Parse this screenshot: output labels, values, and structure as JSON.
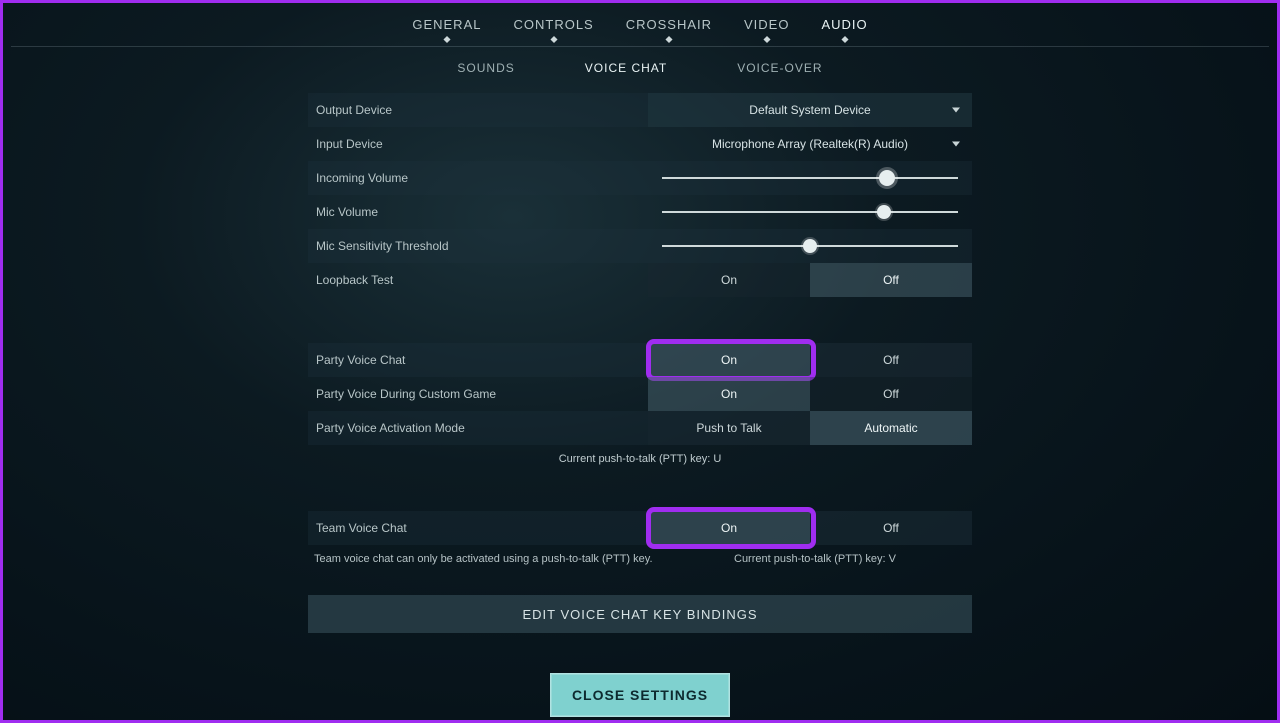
{
  "top_tabs": {
    "general": "GENERAL",
    "controls": "CONTROLS",
    "crosshair": "CROSSHAIR",
    "video": "VIDEO",
    "audio": "AUDIO"
  },
  "sub_tabs": {
    "sounds": "SOUNDS",
    "voice_chat": "VOICE CHAT",
    "voice_over": "VOICE-OVER"
  },
  "settings": {
    "output_device": {
      "label": "Output Device",
      "value": "Default System Device"
    },
    "input_device": {
      "label": "Input Device",
      "value": "Microphone Array (Realtek(R) Audio)"
    },
    "incoming_volume": {
      "label": "Incoming Volume",
      "percent": 76
    },
    "mic_volume": {
      "label": "Mic Volume",
      "percent": 75
    },
    "mic_sensitivity": {
      "label": "Mic Sensitivity Threshold",
      "percent": 50
    },
    "loopback": {
      "label": "Loopback Test",
      "on": "On",
      "off": "Off",
      "selected": "Off"
    },
    "party_voice": {
      "label": "Party Voice Chat",
      "on": "On",
      "off": "Off",
      "selected": "On"
    },
    "party_custom": {
      "label": "Party Voice During Custom Game",
      "on": "On",
      "off": "Off",
      "selected": "On"
    },
    "party_mode": {
      "label": "Party Voice Activation Mode",
      "a": "Push to Talk",
      "b": "Automatic",
      "selected": "Automatic"
    },
    "party_ptt_note": "Current push-to-talk (PTT) key: U",
    "team_voice": {
      "label": "Team Voice Chat",
      "on": "On",
      "off": "Off",
      "selected": "On"
    },
    "team_note_left": "Team voice chat can only be activated using a push-to-talk (PTT) key.",
    "team_note_right": "Current push-to-talk (PTT) key: V",
    "edit_bindings": "EDIT VOICE CHAT KEY BINDINGS",
    "close": "CLOSE SETTINGS"
  }
}
